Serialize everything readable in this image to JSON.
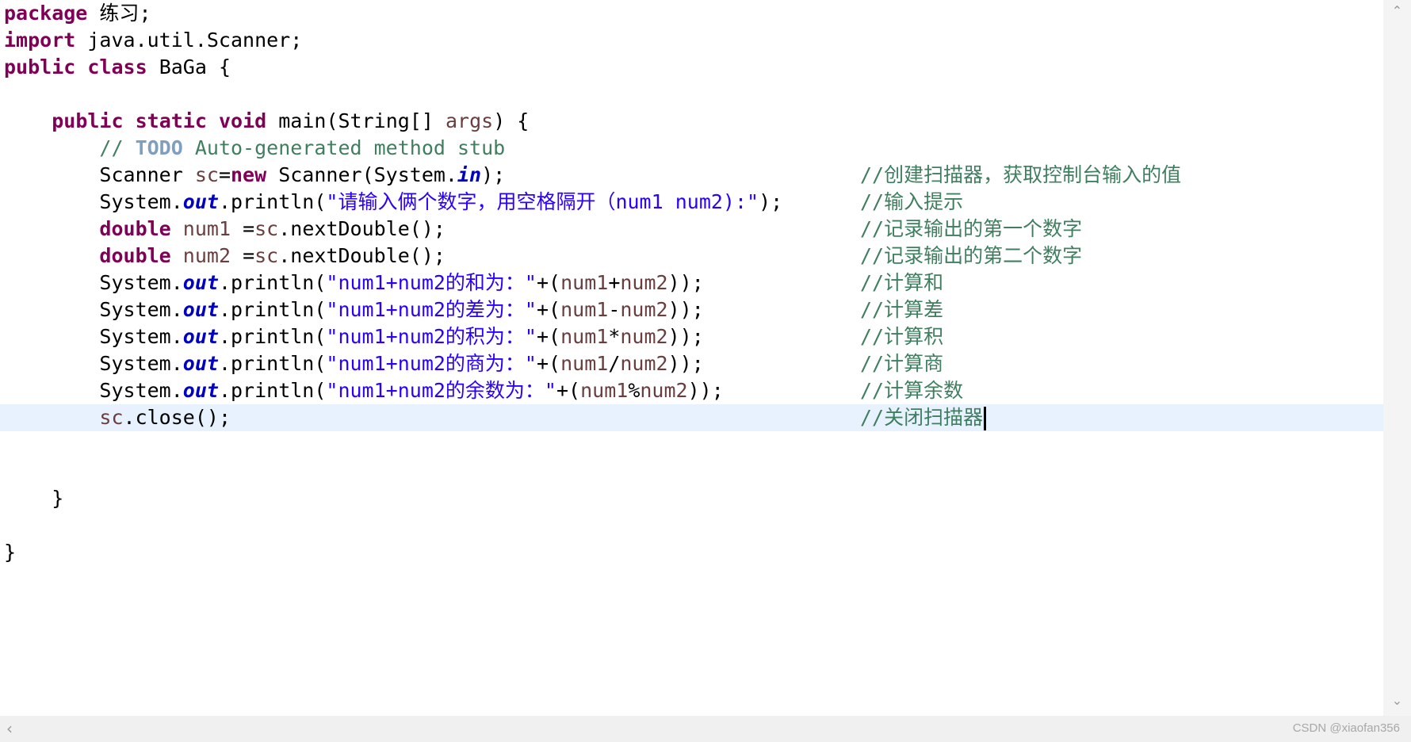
{
  "editor": {
    "lines": [
      {
        "parts": [
          {
            "t": "package",
            "c": "kw"
          },
          {
            "t": " "
          },
          {
            "t": "练习",
            "cjk": true
          },
          {
            "t": ";"
          }
        ]
      },
      {
        "parts": [
          {
            "t": "import",
            "c": "kw"
          },
          {
            "t": " java.util.Scanner;"
          }
        ]
      },
      {
        "parts": [
          {
            "t": "public",
            "c": "kw"
          },
          {
            "t": " "
          },
          {
            "t": "class",
            "c": "kw"
          },
          {
            "t": " BaGa {"
          }
        ]
      },
      {
        "parts": []
      },
      {
        "parts": [
          {
            "t": "    "
          },
          {
            "t": "public",
            "c": "kw"
          },
          {
            "t": " "
          },
          {
            "t": "static",
            "c": "kw"
          },
          {
            "t": " "
          },
          {
            "t": "void",
            "c": "kw"
          },
          {
            "t": " main(String[] "
          },
          {
            "t": "args",
            "c": "var"
          },
          {
            "t": ") {"
          }
        ]
      },
      {
        "parts": [
          {
            "t": "        // ",
            "c": "green"
          },
          {
            "t": "TODO",
            "c": "todo"
          },
          {
            "t": " Auto-generated method stub",
            "c": "green"
          }
        ]
      },
      {
        "parts": [
          {
            "t": "        Scanner "
          },
          {
            "t": "sc",
            "c": "var"
          },
          {
            "t": "="
          },
          {
            "t": "new",
            "c": "kw"
          },
          {
            "t": " Scanner(System."
          },
          {
            "t": "in",
            "c": "fld"
          },
          {
            "t": ");"
          }
        ],
        "comment": "//创建扫描器，获取控制台输入的值"
      },
      {
        "parts": [
          {
            "t": "        System."
          },
          {
            "t": "out",
            "c": "fld"
          },
          {
            "t": ".println("
          },
          {
            "t": "\"请输入俩个数字，用空格隔开（num1 num2):\"",
            "c": "str"
          },
          {
            "t": ");"
          }
        ],
        "comment": "//输入提示"
      },
      {
        "parts": [
          {
            "t": "        "
          },
          {
            "t": "double",
            "c": "kw"
          },
          {
            "t": " "
          },
          {
            "t": "num1",
            "c": "var"
          },
          {
            "t": " ="
          },
          {
            "t": "sc",
            "c": "var"
          },
          {
            "t": ".nextDouble();"
          }
        ],
        "comment": "//记录输出的第一个数字"
      },
      {
        "parts": [
          {
            "t": "        "
          },
          {
            "t": "double",
            "c": "kw"
          },
          {
            "t": " "
          },
          {
            "t": "num2",
            "c": "var"
          },
          {
            "t": " ="
          },
          {
            "t": "sc",
            "c": "var"
          },
          {
            "t": ".nextDouble();"
          }
        ],
        "comment": "//记录输出的第二个数字"
      },
      {
        "parts": [
          {
            "t": "        System."
          },
          {
            "t": "out",
            "c": "fld"
          },
          {
            "t": ".println("
          },
          {
            "t": "\"num1+num2的和为：\"",
            "c": "str"
          },
          {
            "t": "+("
          },
          {
            "t": "num1",
            "c": "var"
          },
          {
            "t": "+"
          },
          {
            "t": "num2",
            "c": "var"
          },
          {
            "t": "));"
          }
        ],
        "comment": "//计算和"
      },
      {
        "parts": [
          {
            "t": "        System."
          },
          {
            "t": "out",
            "c": "fld"
          },
          {
            "t": ".println("
          },
          {
            "t": "\"num1+num2的差为：\"",
            "c": "str"
          },
          {
            "t": "+("
          },
          {
            "t": "num1",
            "c": "var"
          },
          {
            "t": "-"
          },
          {
            "t": "num2",
            "c": "var"
          },
          {
            "t": "));"
          }
        ],
        "comment": "//计算差"
      },
      {
        "parts": [
          {
            "t": "        System."
          },
          {
            "t": "out",
            "c": "fld"
          },
          {
            "t": ".println("
          },
          {
            "t": "\"num1+num2的积为：\"",
            "c": "str"
          },
          {
            "t": "+("
          },
          {
            "t": "num1",
            "c": "var"
          },
          {
            "t": "*"
          },
          {
            "t": "num2",
            "c": "var"
          },
          {
            "t": "));"
          }
        ],
        "comment": "//计算积"
      },
      {
        "parts": [
          {
            "t": "        System."
          },
          {
            "t": "out",
            "c": "fld"
          },
          {
            "t": ".println("
          },
          {
            "t": "\"num1+num2的商为：\"",
            "c": "str"
          },
          {
            "t": "+("
          },
          {
            "t": "num1",
            "c": "var"
          },
          {
            "t": "/"
          },
          {
            "t": "num2",
            "c": "var"
          },
          {
            "t": "));"
          }
        ],
        "comment": "//计算商"
      },
      {
        "parts": [
          {
            "t": "        System."
          },
          {
            "t": "out",
            "c": "fld"
          },
          {
            "t": ".println("
          },
          {
            "t": "\"num1+num2的余数为：\"",
            "c": "str"
          },
          {
            "t": "+("
          },
          {
            "t": "num1",
            "c": "var"
          },
          {
            "t": "%"
          },
          {
            "t": "num2",
            "c": "var"
          },
          {
            "t": "));"
          }
        ],
        "comment": "//计算余数"
      },
      {
        "parts": [
          {
            "t": "        "
          },
          {
            "t": "sc",
            "c": "var"
          },
          {
            "t": ".close();"
          }
        ],
        "comment": "//关闭扫描器",
        "current": true
      },
      {
        "parts": []
      },
      {
        "parts": []
      },
      {
        "parts": [
          {
            "t": "    }"
          }
        ]
      },
      {
        "parts": []
      },
      {
        "parts": [
          {
            "t": "}"
          }
        ]
      }
    ]
  },
  "icons": {
    "scroll_up": "chevron-up-icon",
    "scroll_down": "chevron-down-icon",
    "scroll_left": "chevron-left-icon"
  },
  "watermark": "CSDN @xiaofan356",
  "colors": {
    "keyword": "#7f0055",
    "string": "#2a00ff",
    "comment": "#3f7f5f",
    "field": "#0000c0",
    "variable": "#6a3e3e",
    "current_line": "#e8f2fe"
  }
}
